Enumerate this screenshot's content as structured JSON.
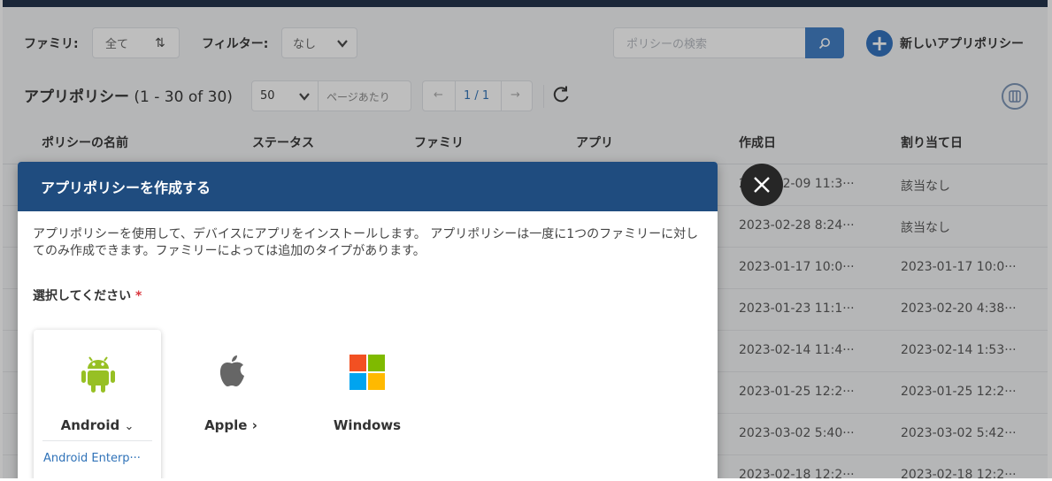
{
  "toolbar": {
    "family_label": "ファミリ:",
    "family_value": "全て",
    "filter_label": "フィルター:",
    "filter_value": "なし",
    "search_placeholder": "ポリシーの検索",
    "new_policy_label": "新しいアプリポリシー"
  },
  "list_header": {
    "title": "アプリポリシー",
    "count": "(1 - 30 of 30)",
    "per_page_value": "50",
    "per_page_label": "ページあたり",
    "page_indicator": "1 / 1",
    "prev_arrow": "←",
    "next_arrow": "→"
  },
  "table": {
    "columns": [
      "ポリシーの名前",
      "ステータス",
      "ファミリ",
      "アプリ",
      "作成日",
      "割り当て日"
    ],
    "rows": [
      {
        "created": "2023-02-09 11:3···",
        "assigned": "該当なし"
      },
      {
        "created": "2023-02-28 8:24···",
        "assigned": "該当なし"
      },
      {
        "created": "2023-01-17 10:0···",
        "assigned": "2023-01-17 10:0···"
      },
      {
        "created": "2023-01-23 11:1···",
        "assigned": "2023-02-20 4:38···"
      },
      {
        "created": "2023-02-14 11:4···",
        "assigned": "2023-02-14 1:53···"
      },
      {
        "created": "2023-01-25 12:2···",
        "assigned": "2023-01-25 12:2···"
      },
      {
        "created": "2023-03-02 5:40···",
        "assigned": "2023-03-02 5:42···"
      },
      {
        "created": "2023-02-18 12:2···",
        "assigned": "2023-02-18 12:2···"
      }
    ]
  },
  "modal": {
    "title": "アプリポリシーを作成する",
    "description": "アプリポリシーを使用して、デバイスにアプリをインストールします。 アプリポリシーは一度に1つのファミリーに対してのみ作成できます。ファミリーによっては追加のタイプがあります。",
    "select_label": "選択してください",
    "required_mark": "*",
    "options": [
      {
        "label": "Android",
        "chevron": "⌄",
        "icon": "android-icon",
        "sub_link": "Android Enterp···"
      },
      {
        "label": "Apple",
        "chevron": "›",
        "icon": "apple-icon"
      },
      {
        "label": "Windows",
        "icon": "windows-icon"
      }
    ]
  },
  "colors": {
    "modal_header": "#1f4c7f",
    "accent": "#2e6fbd",
    "android_green": "#97c024",
    "link": "#2f72b8"
  }
}
